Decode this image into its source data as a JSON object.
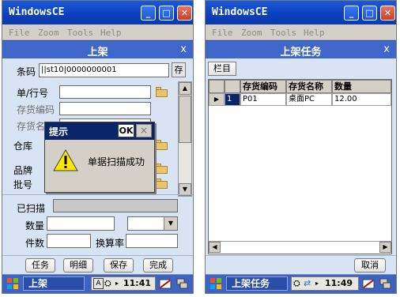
{
  "left": {
    "window_title": "WindowsCE",
    "menu": [
      "File",
      "Zoom",
      "Tools",
      "Help"
    ],
    "form_title": "上架",
    "form_close": "x",
    "barcode_label": "条码",
    "barcode_value": "||st10|0000000001",
    "store_button": "存",
    "order_line_label": "单/行号",
    "item_code_label": "存货编码",
    "item_name_label": "存货名称",
    "warehouse_label": "仓库",
    "brand_label": "品牌",
    "batch_label": "批号",
    "scanned_label": "已扫描",
    "qty_label": "数量",
    "pieces_label": "件数",
    "conv_rate_label": "换算率",
    "buttons": [
      "任务",
      "明细",
      "保存",
      "完成"
    ],
    "dialog": {
      "title": "提示",
      "ok": "OK",
      "close": "×",
      "message": "单据扫描成功"
    },
    "taskbar": {
      "app": "上架",
      "ime": "A",
      "time": "11:41"
    }
  },
  "right": {
    "window_title": "WindowsCE",
    "menu": [
      "File",
      "Zoom",
      "Tools",
      "Help"
    ],
    "form_title": "上架任务",
    "form_close": "x",
    "columns_button": "栏目",
    "table": {
      "headers": [
        "存货编码",
        "存货名称",
        "数量"
      ],
      "rows": [
        {
          "index": "1",
          "code": "P01",
          "name": "桌面PC",
          "qty": "12.00"
        }
      ]
    },
    "cancel_button": "取消",
    "taskbar": {
      "app": "上架任务",
      "time": "11:49"
    }
  }
}
